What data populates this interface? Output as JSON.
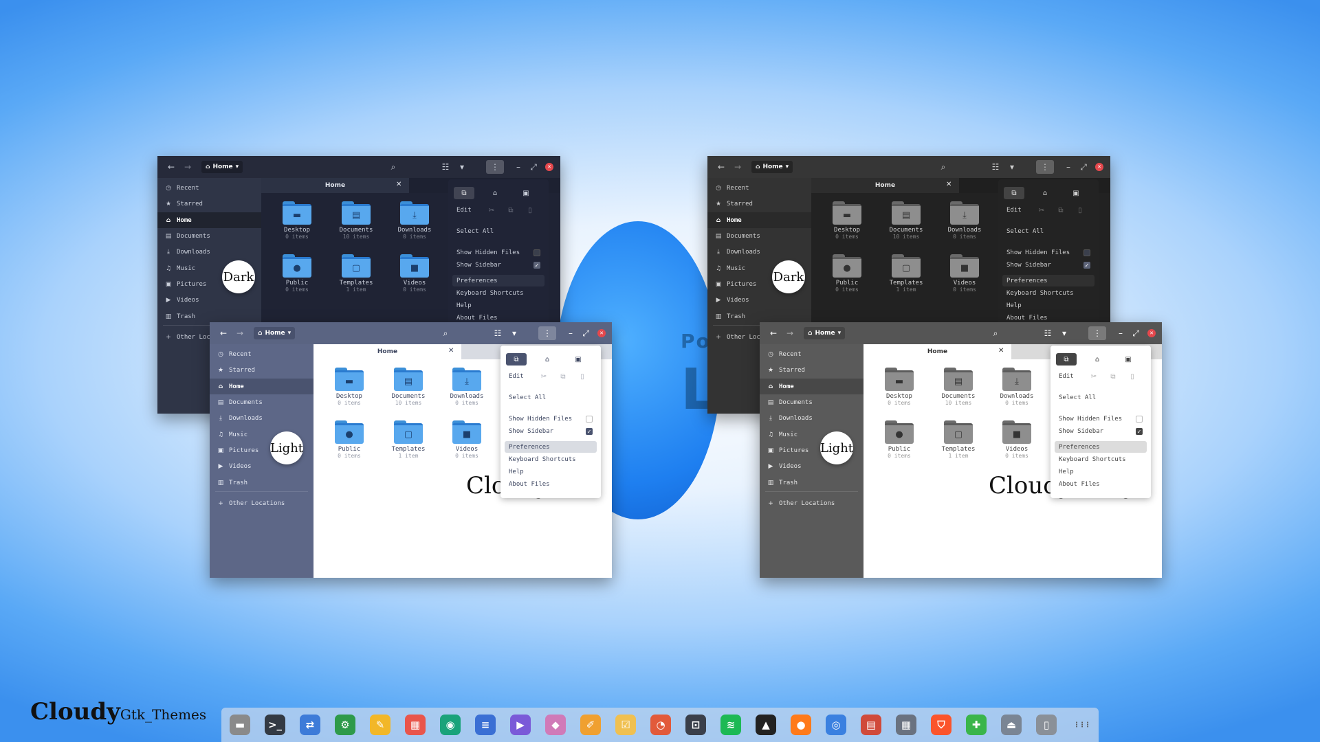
{
  "windows": [
    {
      "theme": "dark",
      "path": "Home",
      "tab": "Home",
      "badge": "Dark"
    },
    {
      "theme": "light",
      "path": "Home",
      "tab": "Home",
      "badge": "Light",
      "caption": "Cloudy"
    },
    {
      "theme": "gdark",
      "path": "Home",
      "tab": "Home",
      "badge": "Dark"
    },
    {
      "theme": "glight",
      "path": "Home",
      "tab": "Home",
      "badge": "Light",
      "caption": "Cloudy-Grey"
    }
  ],
  "sidebar": [
    {
      "label": "Recent",
      "icon": "clock-icon"
    },
    {
      "label": "Starred",
      "icon": "star-icon"
    },
    {
      "label": "Home",
      "icon": "home-icon"
    },
    {
      "label": "Documents",
      "icon": "document-icon"
    },
    {
      "label": "Downloads",
      "icon": "download-icon"
    },
    {
      "label": "Music",
      "icon": "music-icon"
    },
    {
      "label": "Pictures",
      "icon": "picture-icon"
    },
    {
      "label": "Videos",
      "icon": "video-icon"
    },
    {
      "label": "Trash",
      "icon": "trash-icon"
    },
    {
      "label": "Other Locations",
      "icon": "plus-icon"
    }
  ],
  "files": [
    {
      "name": "Desktop",
      "count": "0 items",
      "icon": "desktop-folder-icon"
    },
    {
      "name": "Documents",
      "count": "10 items",
      "icon": "documents-folder-icon"
    },
    {
      "name": "Downloads",
      "count": "0 items",
      "icon": "downloads-folder-icon"
    },
    {
      "name": "Public",
      "count": "0 items",
      "icon": "public-folder-icon"
    },
    {
      "name": "Templates",
      "count": "1 item",
      "icon": "templates-folder-icon"
    },
    {
      "name": "Videos",
      "count": "0 items",
      "icon": "videos-folder-icon"
    }
  ],
  "menu": {
    "edit": "Edit",
    "select_all": "Select All",
    "show_hidden": "Show Hidden Files",
    "show_sidebar": "Show Sidebar",
    "preferences": "Preferences",
    "shortcuts": "Keyboard Shortcuts",
    "help": "Help",
    "about": "About Files",
    "show_hidden_checked": false,
    "show_sidebar_checked": true
  },
  "background_text": {
    "line1": "Powered",
    "line2": "Linux"
  },
  "brand": {
    "main": "Cloudy",
    "sub": "Gtk_Themes"
  },
  "dock": [
    {
      "name": "files-app-icon",
      "color": "#8a8a8a",
      "glyph": "▬"
    },
    {
      "name": "terminal-app-icon",
      "color": "#333a44",
      "glyph": ">_"
    },
    {
      "name": "switch-app-icon",
      "color": "#3d7bd8",
      "glyph": "⇄"
    },
    {
      "name": "hardware-app-icon",
      "color": "#2e9a4a",
      "glyph": "⚙"
    },
    {
      "name": "notes-app-icon",
      "color": "#f2b728",
      "glyph": "✎"
    },
    {
      "name": "calendar-app-icon",
      "color": "#e9554b",
      "glyph": "▦"
    },
    {
      "name": "camera-app-icon",
      "color": "#1aa37a",
      "glyph": "◉"
    },
    {
      "name": "writer-app-icon",
      "color": "#3a6fd4",
      "glyph": "≡"
    },
    {
      "name": "play-app-icon",
      "color": "#7a5ad8",
      "glyph": "▶"
    },
    {
      "name": "flatpak-app-icon",
      "color": "#d07ab8",
      "glyph": "◆"
    },
    {
      "name": "color-picker-app-icon",
      "color": "#f0a030",
      "glyph": "✐"
    },
    {
      "name": "tasks-app-icon",
      "color": "#f0c050",
      "glyph": "☑"
    },
    {
      "name": "color-app-icon",
      "color": "#e25a3a",
      "glyph": "◔"
    },
    {
      "name": "screenshot-app-icon",
      "color": "#3a3f4a",
      "glyph": "⊡"
    },
    {
      "name": "spotify-app-icon",
      "color": "#1db954",
      "glyph": "≋"
    },
    {
      "name": "inkscape-app-icon",
      "color": "#222222",
      "glyph": "▲"
    },
    {
      "name": "firefox-app-icon",
      "color": "#ff7a1a",
      "glyph": "●"
    },
    {
      "name": "chrome-app-icon",
      "color": "#3a80e0",
      "glyph": "◎"
    },
    {
      "name": "news-app-icon",
      "color": "#d04a3a",
      "glyph": "▤"
    },
    {
      "name": "calculator-app-icon",
      "color": "#6a7280",
      "glyph": "▦"
    },
    {
      "name": "brave-app-icon",
      "color": "#fb542b",
      "glyph": "⛉"
    },
    {
      "name": "extensions-app-icon",
      "color": "#3ab54a",
      "glyph": "✚"
    },
    {
      "name": "installer-app-icon",
      "color": "#7a8594",
      "glyph": "⏏"
    },
    {
      "name": "trash-app-icon",
      "color": "#8a9098",
      "glyph": "▯"
    },
    {
      "name": "app-grid-icon",
      "color": "transparent",
      "glyph": "⋮⋮⋮"
    }
  ]
}
